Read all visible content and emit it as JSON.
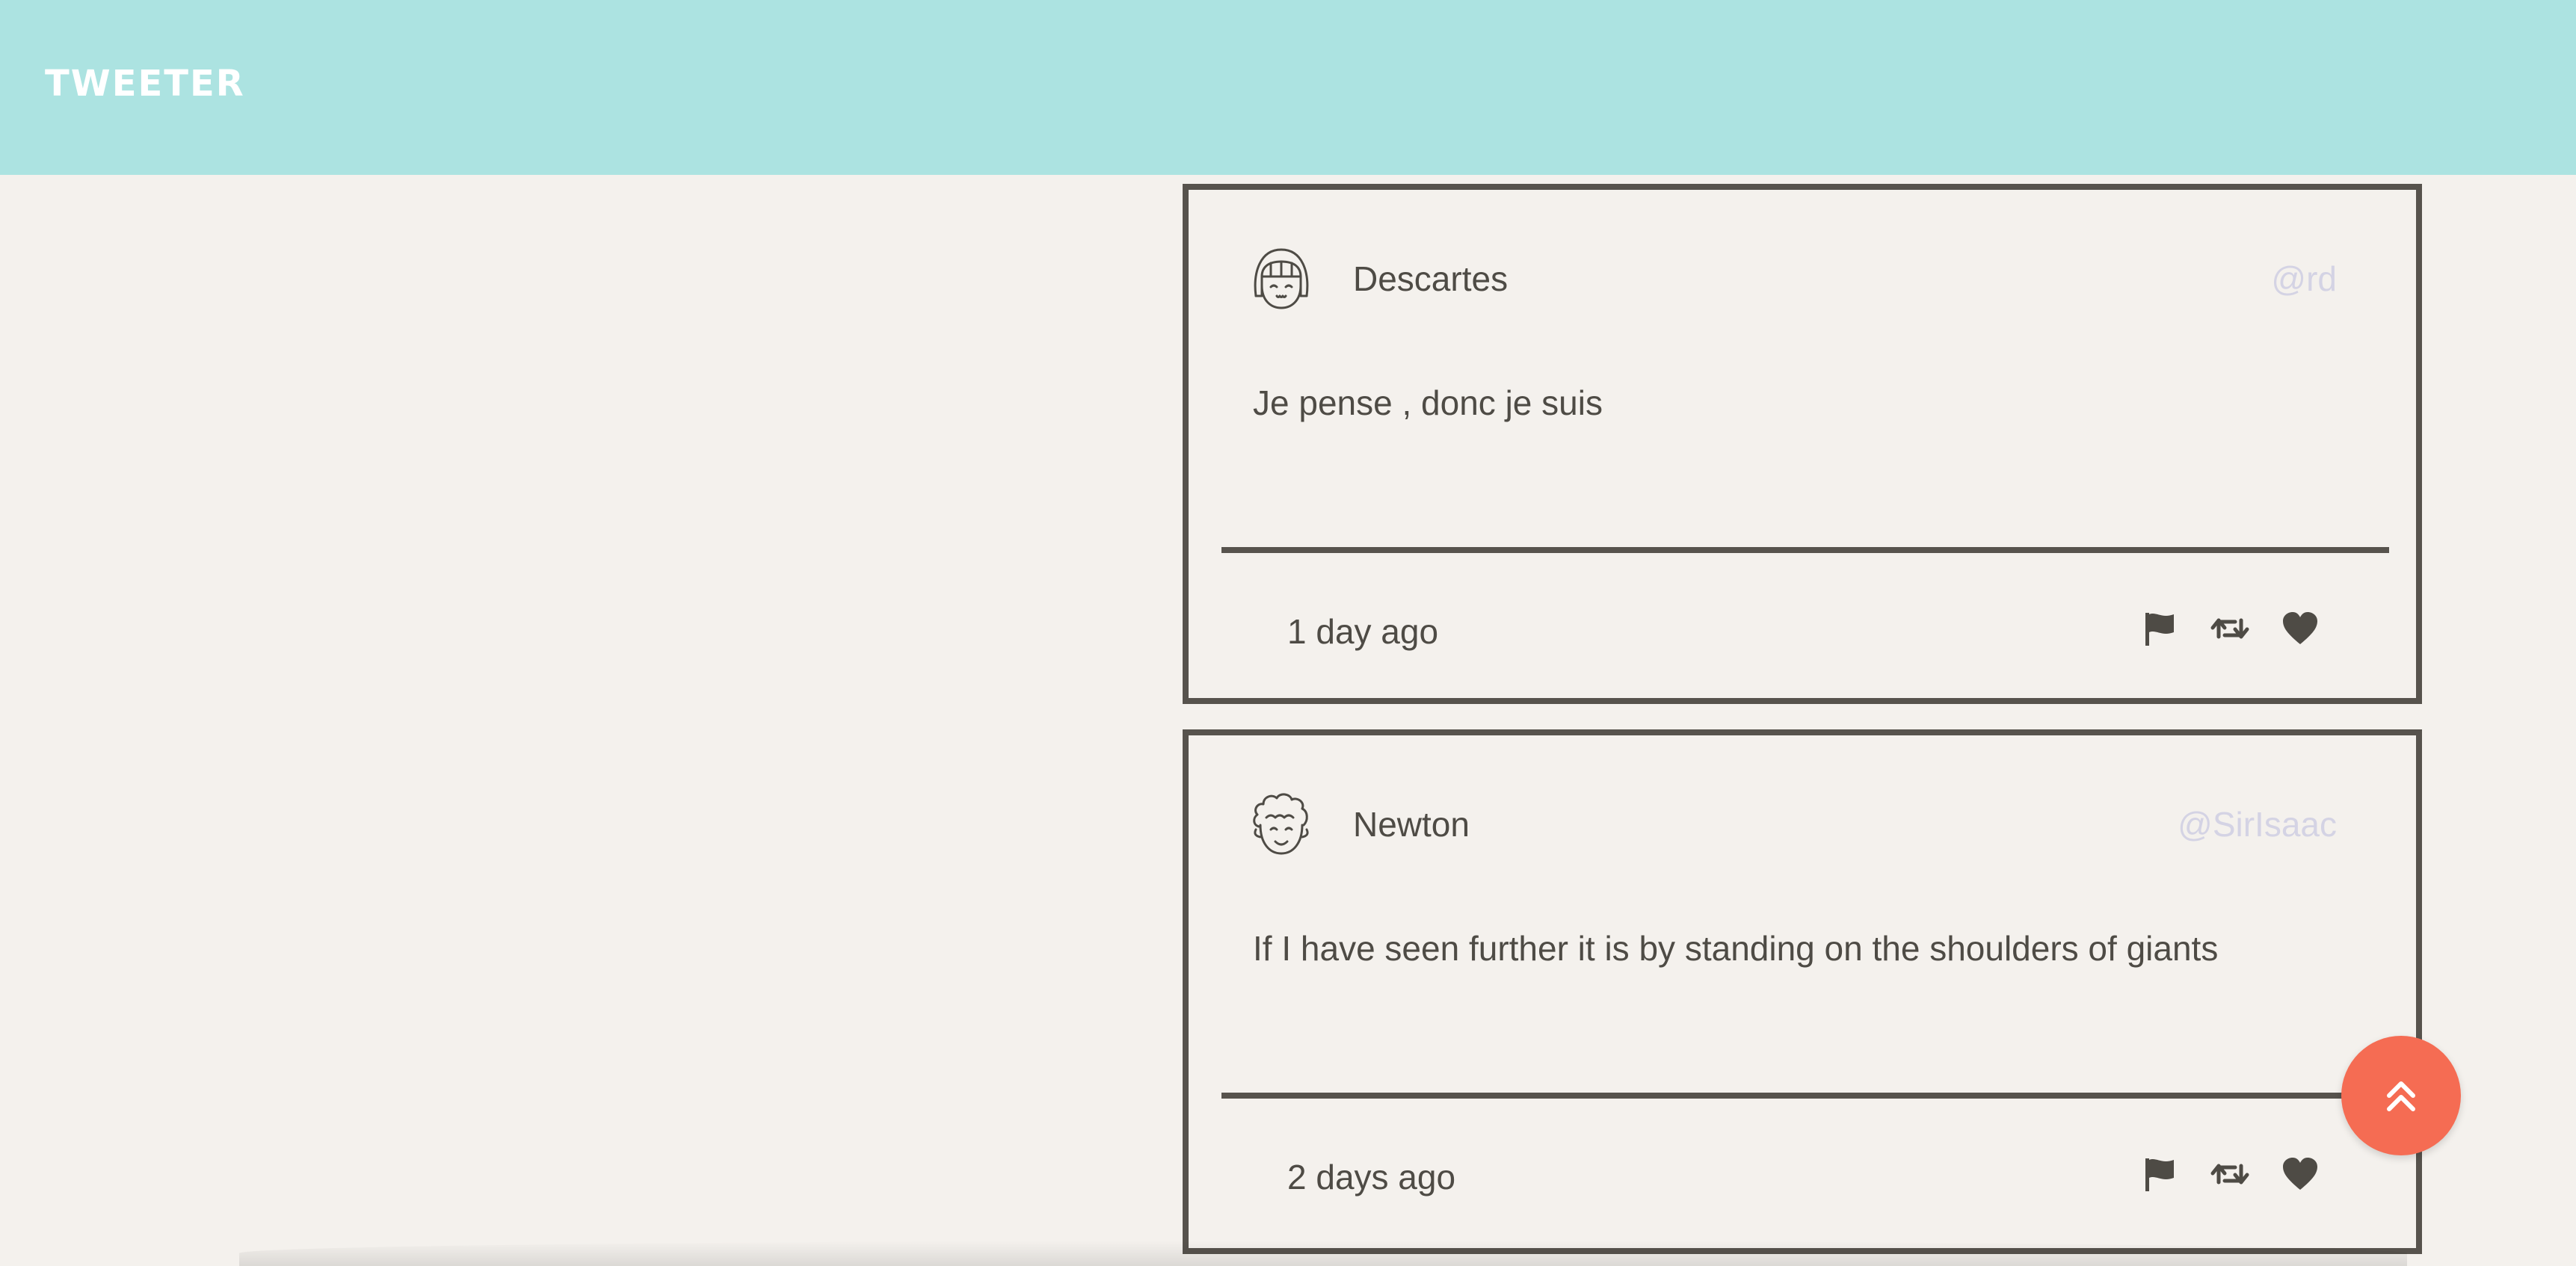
{
  "header": {
    "brand": "TWEETER",
    "background_color": "#ace3e1"
  },
  "tweets": [
    {
      "avatar_icon": "girl-face-avatar-icon",
      "name": "Descartes",
      "handle": "@rd",
      "content": "Je pense , donc je suis",
      "timestamp": "1 day ago",
      "actions": [
        "flag-icon",
        "retweet-icon",
        "heart-icon"
      ]
    },
    {
      "avatar_icon": "curly-hair-face-avatar-icon",
      "name": "Newton",
      "handle": "@SirIsaac",
      "content": "If I have seen further it is by standing on the shoulders of giants",
      "timestamp": "2 days ago",
      "actions": [
        "flag-icon",
        "retweet-icon",
        "heart-icon"
      ]
    }
  ],
  "scroll_top_button": {
    "icon": "double-chevron-up-icon",
    "color": "#f56c53"
  },
  "colors": {
    "page_background": "#f4f1ed",
    "border": "#57534d",
    "handle_text": "#d4d3e4"
  }
}
